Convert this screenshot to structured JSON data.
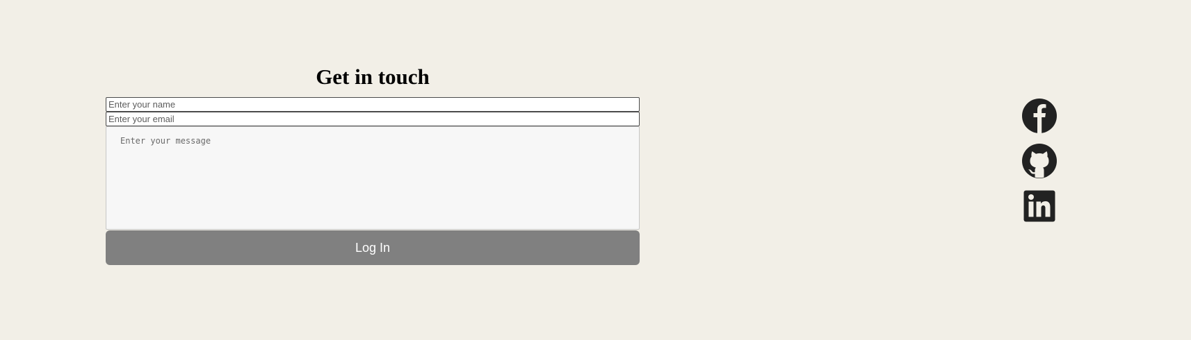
{
  "contact": {
    "title": "Get in touch",
    "name_placeholder": "Enter your name",
    "email_placeholder": "Enter your email",
    "message_placeholder": "Enter your message",
    "submit_label": "Log In"
  },
  "social": [
    {
      "icon": "facebook-icon"
    },
    {
      "icon": "github-icon"
    },
    {
      "icon": "linkedin-icon"
    }
  ],
  "colors": {
    "background": "#f2efe7",
    "button": "#808080",
    "icon": "#222222"
  }
}
